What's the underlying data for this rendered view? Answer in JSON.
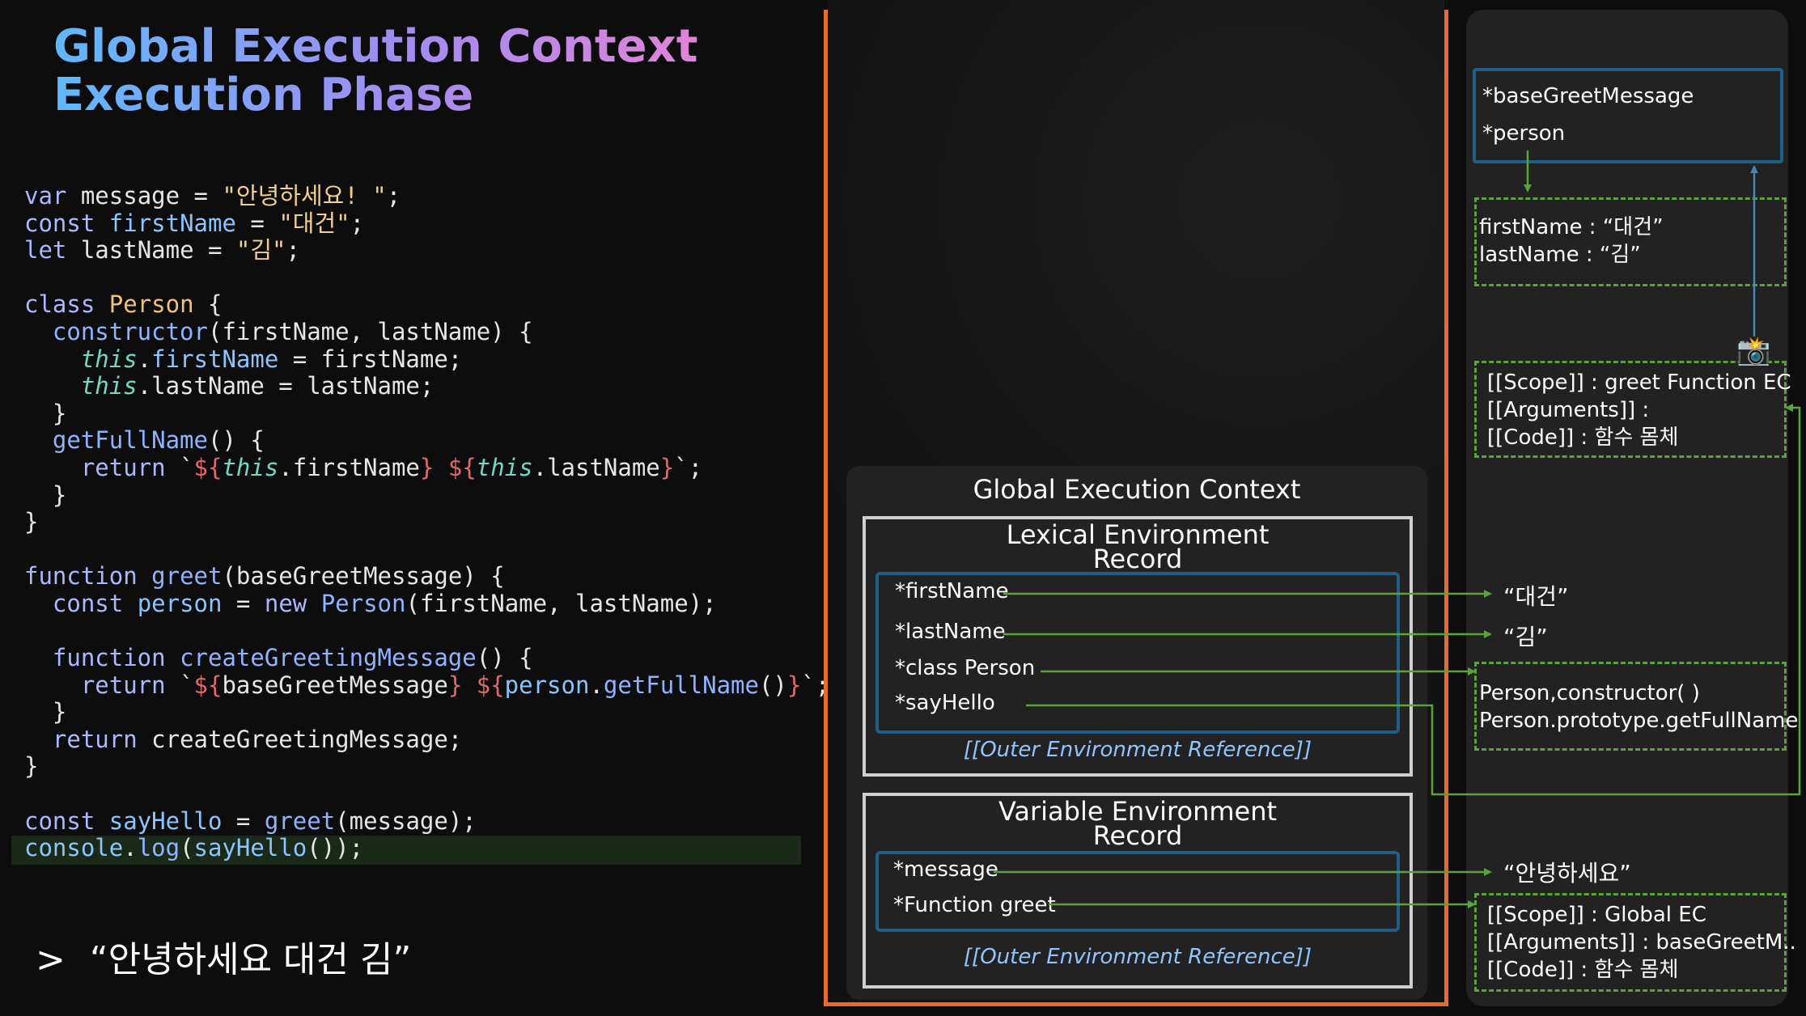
{
  "title": {
    "line1": "Global Execution Context",
    "line2": "Execution Phase"
  },
  "code": {
    "lines": [
      [
        {
          "t": "var",
          "c": "kw"
        },
        {
          "t": " message = ",
          "c": "pu"
        },
        {
          "t": "\"안녕하세요! \"",
          "c": "st"
        },
        {
          "t": ";",
          "c": "pu"
        }
      ],
      [
        {
          "t": "const",
          "c": "kw"
        },
        {
          "t": " ",
          "c": "pu"
        },
        {
          "t": "firstName",
          "c": "pr"
        },
        {
          "t": " = ",
          "c": "pu"
        },
        {
          "t": "\"대건\"",
          "c": "st"
        },
        {
          "t": ";",
          "c": "pu"
        }
      ],
      [
        {
          "t": "let",
          "c": "kw"
        },
        {
          "t": " lastName = ",
          "c": "pu"
        },
        {
          "t": "\"김\"",
          "c": "st"
        },
        {
          "t": ";",
          "c": "pu"
        }
      ],
      [],
      [
        {
          "t": "class",
          "c": "kw"
        },
        {
          "t": " ",
          "c": "pu"
        },
        {
          "t": "Person",
          "c": "cls"
        },
        {
          "t": " {",
          "c": "pu"
        }
      ],
      [
        {
          "t": "  ",
          "c": "pu"
        },
        {
          "t": "constructor",
          "c": "fn"
        },
        {
          "t": "(firstName, lastName) {",
          "c": "pu"
        }
      ],
      [
        {
          "t": "    ",
          "c": "pu"
        },
        {
          "t": "this",
          "c": "th"
        },
        {
          "t": ".",
          "c": "pu"
        },
        {
          "t": "firstName",
          "c": "pr"
        },
        {
          "t": " = firstName;",
          "c": "pu"
        }
      ],
      [
        {
          "t": "    ",
          "c": "pu"
        },
        {
          "t": "this",
          "c": "th"
        },
        {
          "t": ".lastName = lastName;",
          "c": "pu"
        }
      ],
      [
        {
          "t": "  }",
          "c": "pu"
        }
      ],
      [
        {
          "t": "  ",
          "c": "pu"
        },
        {
          "t": "getFullName",
          "c": "fn"
        },
        {
          "t": "() {",
          "c": "pu"
        }
      ],
      [
        {
          "t": "    ",
          "c": "pu"
        },
        {
          "t": "return",
          "c": "kw"
        },
        {
          "t": " `",
          "c": "pu"
        },
        {
          "t": "${",
          "c": "tp"
        },
        {
          "t": "this",
          "c": "th"
        },
        {
          "t": ".firstName",
          "c": "pu"
        },
        {
          "t": "}",
          "c": "tp"
        },
        {
          "t": " ",
          "c": "pu"
        },
        {
          "t": "${",
          "c": "tp"
        },
        {
          "t": "this",
          "c": "th"
        },
        {
          "t": ".lastName",
          "c": "pu"
        },
        {
          "t": "}",
          "c": "tp"
        },
        {
          "t": "`;",
          "c": "pu"
        }
      ],
      [
        {
          "t": "  }",
          "c": "pu"
        }
      ],
      [
        {
          "t": "}",
          "c": "pu"
        }
      ],
      [],
      [
        {
          "t": "function",
          "c": "kw"
        },
        {
          "t": " ",
          "c": "pu"
        },
        {
          "t": "greet",
          "c": "fn"
        },
        {
          "t": "(baseGreetMessage) {",
          "c": "pu"
        }
      ],
      [
        {
          "t": "  ",
          "c": "pu"
        },
        {
          "t": "const",
          "c": "kw"
        },
        {
          "t": " ",
          "c": "pu"
        },
        {
          "t": "person",
          "c": "pr"
        },
        {
          "t": " = ",
          "c": "pu"
        },
        {
          "t": "new",
          "c": "kw"
        },
        {
          "t": " ",
          "c": "pu"
        },
        {
          "t": "Person",
          "c": "fn"
        },
        {
          "t": "(firstName, lastName);",
          "c": "pu"
        }
      ],
      [],
      [
        {
          "t": "  ",
          "c": "pu"
        },
        {
          "t": "function",
          "c": "kw"
        },
        {
          "t": " ",
          "c": "pu"
        },
        {
          "t": "createGreetingMessage",
          "c": "fn"
        },
        {
          "t": "() {",
          "c": "pu"
        }
      ],
      [
        {
          "t": "    ",
          "c": "pu"
        },
        {
          "t": "return",
          "c": "kw"
        },
        {
          "t": " `",
          "c": "pu"
        },
        {
          "t": "${",
          "c": "tp"
        },
        {
          "t": "baseGreetMessage",
          "c": "pu"
        },
        {
          "t": "}",
          "c": "tp"
        },
        {
          "t": " ",
          "c": "pu"
        },
        {
          "t": "${",
          "c": "tp"
        },
        {
          "t": "person",
          "c": "pr"
        },
        {
          "t": ".",
          "c": "pu"
        },
        {
          "t": "getFullName",
          "c": "fn"
        },
        {
          "t": "()",
          "c": "pu"
        },
        {
          "t": "}",
          "c": "tp"
        },
        {
          "t": "`;",
          "c": "pu"
        }
      ],
      [
        {
          "t": "  }",
          "c": "pu"
        }
      ],
      [
        {
          "t": "  ",
          "c": "pu"
        },
        {
          "t": "return",
          "c": "kw"
        },
        {
          "t": " createGreetingMessage;",
          "c": "pu"
        }
      ],
      [
        {
          "t": "}",
          "c": "pu"
        }
      ],
      [],
      [
        {
          "t": "const",
          "c": "kw"
        },
        {
          "t": " ",
          "c": "pu"
        },
        {
          "t": "sayHello",
          "c": "pr"
        },
        {
          "t": " = ",
          "c": "pu"
        },
        {
          "t": "greet",
          "c": "fn"
        },
        {
          "t": "(message);",
          "c": "pu"
        }
      ],
      [
        {
          "t": "console",
          "c": "pr"
        },
        {
          "t": ".",
          "c": "pu"
        },
        {
          "t": "log",
          "c": "fn"
        },
        {
          "t": "(",
          "c": "pu"
        },
        {
          "t": "sayHello",
          "c": "pr"
        },
        {
          "t": "());",
          "c": "pu"
        }
      ]
    ]
  },
  "output": {
    "prompt": ">",
    "text": "“안녕하세요 대건 김”"
  },
  "gec": {
    "title": "Global Execution Context",
    "lexical": {
      "title_line1": "Lexical Environment",
      "title_line2": "Record",
      "entries": [
        "*firstName",
        "*lastName",
        "*class Person",
        "*sayHello"
      ],
      "outer": "[[Outer Environment Reference]]"
    },
    "variable": {
      "title_line1": "Variable Environment",
      "title_line2": "Record",
      "entries": [
        "*message",
        "*Function greet"
      ],
      "outer": "[[Outer Environment Reference]]"
    }
  },
  "right": {
    "greet_env": [
      "*baseGreetMessage",
      "*person"
    ],
    "person_obj": [
      "firstName : “대건”",
      "lastName : “김”"
    ],
    "closure": [
      "[[Scope]]  : greet Function EC",
      "[[Arguments]] :",
      "[[Code]] : 함수 몸체"
    ],
    "camera_icon": "📸",
    "val_firstname": "“대건”",
    "val_lastname": "“김”",
    "class_obj": [
      "Person,constructor( )",
      "Person.prototype.getFullName"
    ],
    "val_message": "“안녕하세요”",
    "greet_fn": [
      "[[Scope]]  : Global EC",
      "[[Arguments]] : baseGreetM..",
      "[[Code]] : 함수 몸체"
    ]
  },
  "colors": {
    "frame": "#e66a2b",
    "arrow": "#5aa33a",
    "blue_box": "#1f5f86",
    "outer_ref": "#8fc4ff"
  }
}
